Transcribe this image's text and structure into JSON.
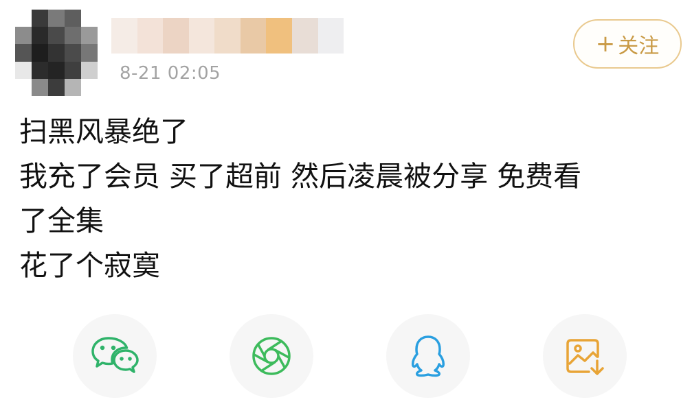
{
  "post": {
    "timestamp": "8-21 02:05",
    "follow_label": "关注",
    "follow_plus": "+",
    "lines": [
      "扫黑风暴绝了",
      "我充了会员  买了超前  然后凌晨被分享  免费看",
      "了全集",
      "花了个寂寞"
    ]
  },
  "share": {
    "items": [
      {
        "icon": "wechat-icon",
        "color": "#2fb36a"
      },
      {
        "icon": "moments-icon",
        "color": "#3dbb5c"
      },
      {
        "icon": "qq-icon",
        "color": "#2a9fe0"
      },
      {
        "icon": "save-image-icon",
        "color": "#e8a436"
      }
    ]
  },
  "colors": {
    "follow_border": "#e9c98e",
    "follow_text": "#c99a45",
    "timestamp": "#a3a3a3",
    "body_text": "#111111"
  }
}
